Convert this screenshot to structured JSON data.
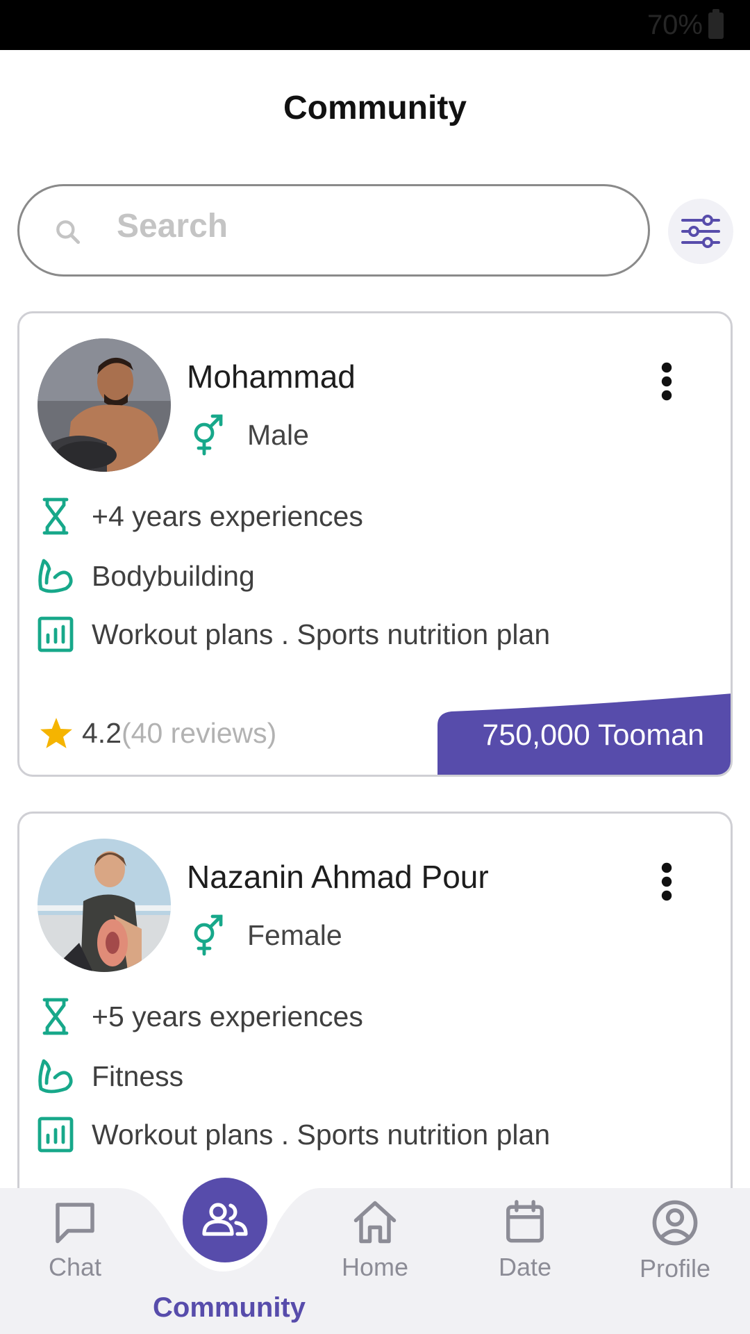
{
  "status_bar": {
    "battery_percent": "70%"
  },
  "header": {
    "title": "Community"
  },
  "search": {
    "placeholder": "Search"
  },
  "coaches": [
    {
      "name": "Mohammad",
      "gender": "Male",
      "experience": "+4 years experiences",
      "specialty": "Bodybuilding",
      "services": "Workout plans . Sports nutrition plan",
      "rating": "4.2",
      "reviews": "(40 reviews)",
      "price": "750,000 Tooman"
    },
    {
      "name": "Nazanin Ahmad Pour",
      "gender": "Female",
      "experience": "+5 years experiences",
      "specialty": "Fitness",
      "services": "Workout plans . Sports nutrition plan"
    }
  ],
  "bottom_nav": {
    "chat": "Chat",
    "community": "Community",
    "home": "Home",
    "date": "Date",
    "profile": "Profile"
  },
  "colors": {
    "accent": "#574cab",
    "icon_teal": "#17a88a",
    "star": "#f5b400",
    "nav_inactive": "#8c8c96"
  },
  "icons": {
    "search": "search-icon",
    "filter": "sliders-icon",
    "gender": "gender-icon",
    "experience": "hourglass-icon",
    "specialty": "bicep-icon",
    "services": "chart-icon",
    "more": "more-vertical-icon",
    "rating": "star-icon"
  }
}
